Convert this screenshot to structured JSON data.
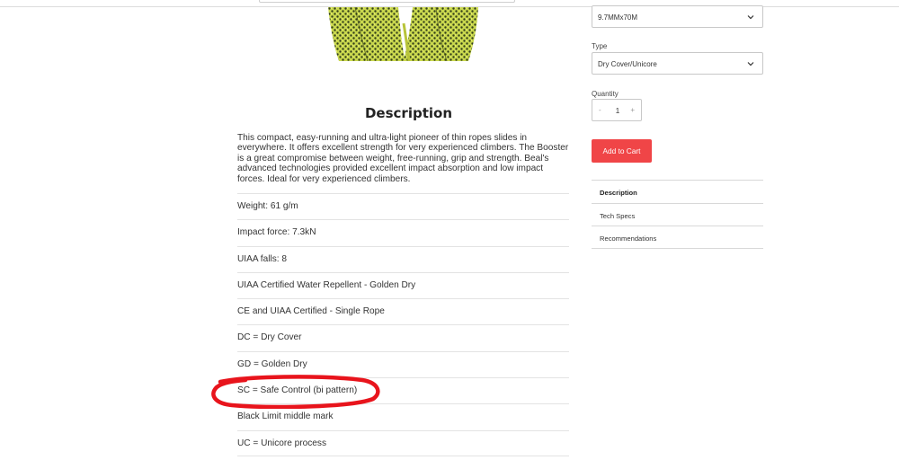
{
  "product": {
    "length_select": {
      "value": "9.7MMx70M"
    },
    "type_select": {
      "label": "Type",
      "value": "Dry Cover/Unicore"
    },
    "quantity": {
      "label": "Quantity",
      "value": "1",
      "minus": "-",
      "plus": "+"
    },
    "add_to_cart_label": "Add to Cart"
  },
  "tabs": [
    {
      "label": "Description",
      "active": true
    },
    {
      "label": "Tech Specs",
      "active": false
    },
    {
      "label": "Recommendations",
      "active": false
    }
  ],
  "description": {
    "title": "Description",
    "paragraph": "This compact, easy-running and ultra-light pioneer of thin ropes slides in everywhere. It offers excellent strength for very experienced climbers. The Booster is a great compromise between weight, free-running, grip and strength. Beal's advanced technologies provided excellent impact absorption and low impact forces. Ideal for very experienced climbers.",
    "specs": [
      "Weight: 61 g/m",
      "Impact force: 7.3kN",
      "UIAA falls: 8",
      "UIAA Certified Water Repellent - Golden Dry",
      "CE and UIAA Certified - Single Rope",
      "DC = Dry Cover",
      "GD = Golden Dry",
      "SC = Safe Control (bi pattern)",
      "Black Limit middle mark",
      "UC = Unicore process"
    ]
  },
  "annotation": {
    "color": "#e8141c",
    "highlighted_spec": "SC = Safe Control (bi pattern)"
  },
  "colors": {
    "accent": "#f04547",
    "rope_base": "#c8d64a",
    "rope_pattern": "#3d4a1e"
  }
}
